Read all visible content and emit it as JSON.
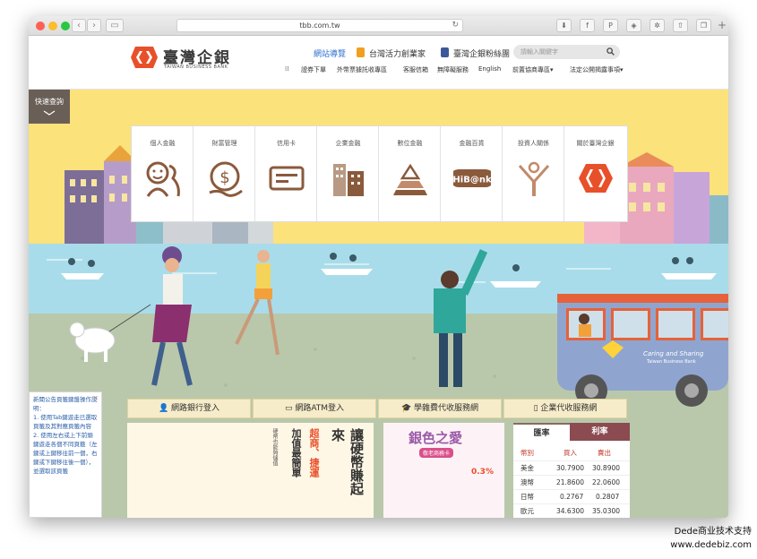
{
  "browser": {
    "url": "tbb.com.tw"
  },
  "site": {
    "brand_name": "臺灣企銀",
    "brand_sub": "TAIWAN BUSINESS BANK",
    "top_links": [
      {
        "label": "網站導覽"
      },
      {
        "label": "台灣活力創業家"
      },
      {
        "label": "臺灣企銀粉絲團"
      }
    ],
    "search_placeholder": "請輸入關鍵字",
    "sub_nav": [
      {
        "label": "⁞⁞"
      },
      {
        "label": "證券下單"
      },
      {
        "label": "外幣票據託收專區"
      },
      {
        "label": "客服信箱"
      },
      {
        "label": "無障礙服務"
      },
      {
        "label": "English"
      },
      {
        "label": "前置協商專區▾"
      },
      {
        "label": "法定公開揭露事項▾"
      }
    ],
    "quick_query": "快速查詢",
    "mega_menu": [
      {
        "label": "個人金融"
      },
      {
        "label": "財富管理"
      },
      {
        "label": "信用卡"
      },
      {
        "label": "企業金融"
      },
      {
        "label": "數位金融"
      },
      {
        "label": "金融百貨"
      },
      {
        "label": "投資人關係"
      },
      {
        "label": "關於臺灣企銀"
      }
    ],
    "bus_text": "Caring and Sharing",
    "bus_sub": "Taiwan Business Bank",
    "quick_links": [
      {
        "label": "網路銀行登入"
      },
      {
        "label": "網路ATM登入"
      },
      {
        "label": "學雜費代收服務網"
      },
      {
        "label": "企業代收服務網"
      }
    ],
    "notice": {
      "title": "新聞公告頁籤鍵盤操作說明：",
      "line1": "1. 使用Tab鍵遊走已選取頁籤及其對應頁籤內容",
      "line2": "2. 使用左右或上下前頭鍵遊走各個不同頁籤（左鍵或上鍵移往前一個，右鍵或下鍵移往後一個），並選取該頁籤"
    },
    "promo1": {
      "headline": "讓硬幣賺起來",
      "line2": "超商、捷運",
      "line3": "加值最簡單",
      "tag": "硬幣也能夠儲值"
    },
    "promo2": {
      "headline": "銀色之愛",
      "sub": "敬老商務卡",
      "rate": "0.3%"
    },
    "rates": {
      "tab_exchange": "匯率",
      "tab_interest": "利率",
      "col_currency": "幣別",
      "col_buy": "買入",
      "col_sell": "賣出",
      "rows": [
        {
          "currency": "美金",
          "buy": "30.7900",
          "sell": "30.8900"
        },
        {
          "currency": "澳幣",
          "buy": "21.8600",
          "sell": "22.0600"
        },
        {
          "currency": "日幣",
          "buy": "0.2767",
          "sell": "0.2807"
        },
        {
          "currency": "歐元",
          "buy": "34.6300",
          "sell": "35.0300"
        }
      ]
    }
  },
  "watermark": {
    "line1": "Dede商业技术支持",
    "line2": "www.dedebiz.com"
  },
  "colors": {
    "brand_orange": "#e8502a",
    "hero_yellow": "#fce27a",
    "menu_icon_brown": "#8a5a3c",
    "rate_tab_red": "#8b4b50"
  }
}
